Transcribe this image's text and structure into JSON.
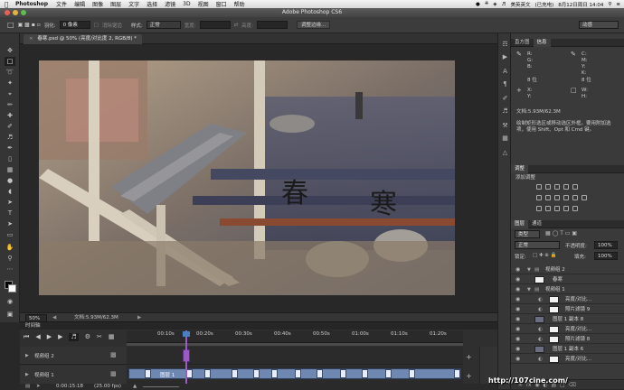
{
  "menubar": {
    "app": "Photoshop",
    "items": [
      "文件",
      "编辑",
      "图像",
      "图层",
      "文字",
      "选择",
      "滤镜",
      "3D",
      "视图",
      "窗口",
      "帮助"
    ],
    "right_input": "美英英文",
    "right_battery": "(已充电)",
    "right_datetime": "8月12日周日 14:04"
  },
  "window": {
    "title": "Adobe Photoshop CS6"
  },
  "options": {
    "feather_label": "羽化:",
    "feather_value": "0 像素",
    "antialias_label": "消除锯齿",
    "style_label": "样式:",
    "style_value": "正常",
    "width_label": "宽度:",
    "height_label": "高度:",
    "refine_button": "调整边缘...",
    "workspace": "动感"
  },
  "document": {
    "tab": "春寒.psd @ 50% (亮度/对比度 2, RGB/8) *",
    "overlay_text_1": "春",
    "overlay_text_2": "寒"
  },
  "status": {
    "zoom": "50%",
    "doc": "文档:5.93M/62.3M"
  },
  "info_panel": {
    "tabs": [
      "直方图",
      "信息"
    ],
    "r": "R:",
    "g": "G:",
    "b": "B:",
    "c": "C:",
    "m": "M:",
    "y": "Y:",
    "k": "K:",
    "bit1": "8 位",
    "bit2": "8 位",
    "x": "X:",
    "yy": "Y:",
    "w": "W:",
    "h": "H:",
    "doc": "文档:5.93M/62.3M",
    "hint": "绘制矩形选区或移动选区外框。要用附加选项，使用 Shift、Opt 和 Cmd 键。"
  },
  "adjustments": {
    "tab": "调整",
    "title": "添加调整"
  },
  "layers_panel": {
    "tabs": [
      "图层",
      "通道"
    ],
    "kind": "类型",
    "blend": "正常",
    "opacity_label": "不透明度:",
    "opacity": "100%",
    "lock_label": "锁定:",
    "fill_label": "填充:",
    "fill": "100%",
    "layers": [
      {
        "name": "视频组 2",
        "type": "group"
      },
      {
        "name": "春寒",
        "type": "layer"
      },
      {
        "name": "视频组 1",
        "type": "group"
      },
      {
        "name": "亮度/对比...",
        "type": "adj"
      },
      {
        "name": "照片滤镜 9",
        "type": "adj"
      },
      {
        "name": "图层 1 副本 8",
        "type": "layer"
      },
      {
        "name": "亮度/对比...",
        "type": "adj"
      },
      {
        "name": "照片滤镜 8",
        "type": "adj"
      },
      {
        "name": "图层 1 副本 6",
        "type": "layer"
      },
      {
        "name": "亮度/对比...",
        "type": "adj"
      }
    ]
  },
  "timeline": {
    "tab": "时间轴",
    "ruler": [
      "00:10s",
      "00:20s",
      "00:30s",
      "00:40s",
      "00:50s",
      "01:00s",
      "01:10s",
      "01:20s"
    ],
    "track1": "视频组 2",
    "track2": "视频组 1",
    "clip_label": "图层 1",
    "timecode": "0:00:15:18",
    "fps": "(25.00 fps)"
  },
  "watermark": "http://107cine.com/",
  "colors": {
    "accent": "#4a7fc1",
    "clip": "#6f88b2",
    "playhead": "#9b5bc7"
  }
}
